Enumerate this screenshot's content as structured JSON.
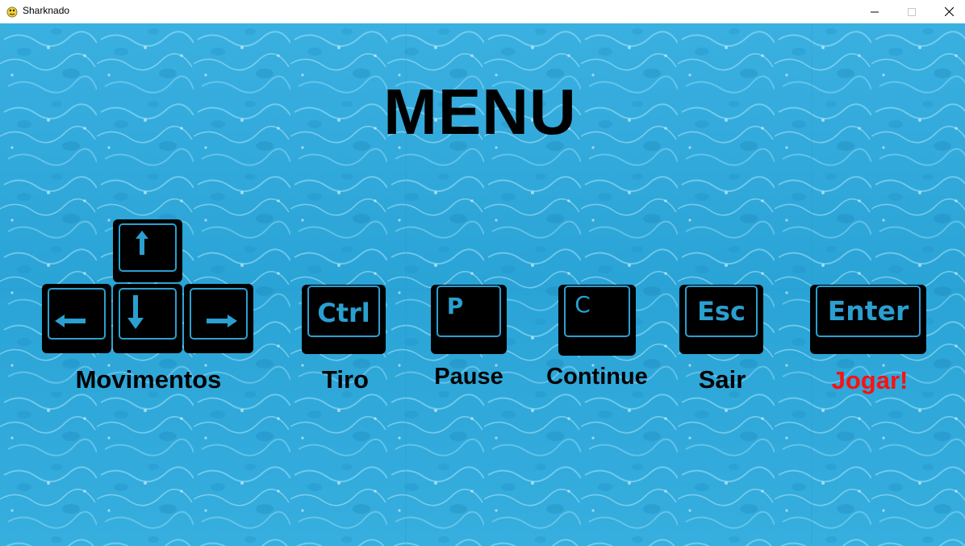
{
  "window": {
    "title": "Sharknado"
  },
  "menu": {
    "title": "MENU",
    "controls": [
      {
        "key": "arrows",
        "label": "Movimentos"
      },
      {
        "key": "Ctrl",
        "label": "Tiro"
      },
      {
        "key": "P",
        "label": "Pause"
      },
      {
        "key": "C",
        "label": "Continue"
      },
      {
        "key": "Esc",
        "label": "Sair"
      },
      {
        "key": "Enter",
        "label": "Jogar!"
      }
    ]
  },
  "colors": {
    "water": "#2aa6d8",
    "key_body": "#000000",
    "key_glyph": "#2a9fd0",
    "label": "#000000",
    "play_label": "#ff1010"
  }
}
